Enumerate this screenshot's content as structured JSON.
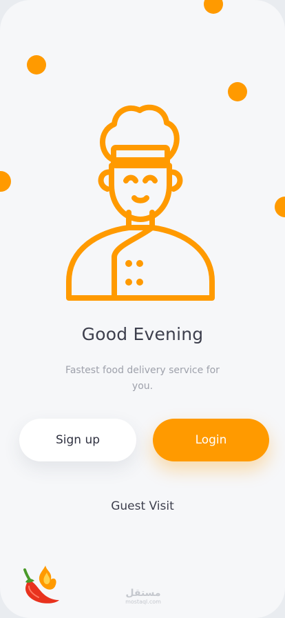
{
  "colors": {
    "accent": "#ff9a00",
    "background": "#f6f7f9",
    "text_dark": "#3d3f4d",
    "text_muted": "#9ea1ab"
  },
  "illustration": {
    "icon": "chef-icon"
  },
  "welcome": {
    "title": "Good Evening",
    "subtitle": "Fastest food delivery service for you."
  },
  "buttons": {
    "signup_label": "Sign up",
    "login_label": "Login"
  },
  "guest_link": "Guest Visit",
  "logo": {
    "icon": "chili-pepper-icon"
  },
  "watermark": {
    "arabic": "مستقل",
    "latin": "mostaql.com"
  }
}
